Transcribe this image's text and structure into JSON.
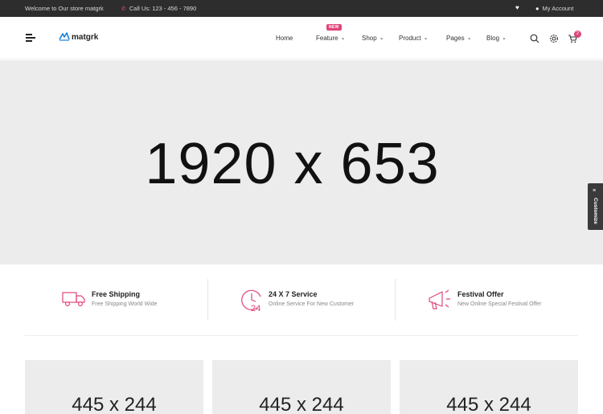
{
  "topbar": {
    "welcome": "Welcome to Our store matgrk",
    "phone": "Call Us: 123 - 456 - 7890",
    "account": "My Account"
  },
  "header": {
    "logo": "matgrk",
    "nav": [
      {
        "label": "Home"
      },
      {
        "label": "Feature",
        "badge": "NEW"
      },
      {
        "label": "Shop"
      },
      {
        "label": "Product"
      },
      {
        "label": "Pages"
      },
      {
        "label": "Blog"
      }
    ],
    "cart_count": "2"
  },
  "hero": {
    "placeholder": "1920 x 653"
  },
  "customize": {
    "label": "Customize"
  },
  "services": [
    {
      "title": "Free Shipping",
      "subtitle": "Free Shipping World Wide"
    },
    {
      "title": "24 X 7 Service",
      "subtitle": "Online Service For New Customer"
    },
    {
      "title": "Festival Offer",
      "subtitle": "New Online Special Festival Offer"
    }
  ],
  "banners": [
    {
      "placeholder": "445 x 244"
    },
    {
      "placeholder": "445 x 244"
    },
    {
      "placeholder": "445 x 244"
    }
  ],
  "colors": {
    "accent": "#e0457b",
    "topbar_bg": "#2d2d2d",
    "placeholder_bg": "#ececec"
  },
  "icons": [
    "phone-icon",
    "heart-icon",
    "user-icon",
    "menu-icon",
    "search-icon",
    "settings-icon",
    "cart-icon",
    "truck-icon",
    "clock-24-icon",
    "megaphone-icon"
  ]
}
